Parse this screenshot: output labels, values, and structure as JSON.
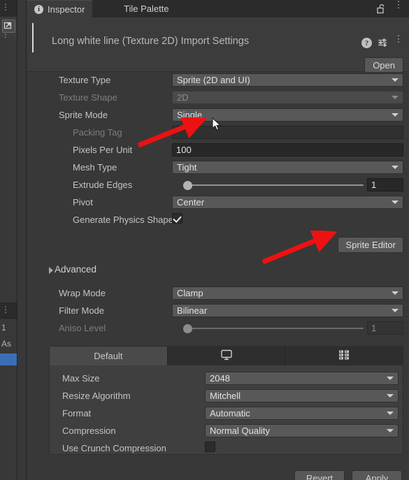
{
  "window": {
    "tabs": [
      {
        "label": "Inspector",
        "icon": "info-icon",
        "active": true
      },
      {
        "label": "Tile Palette",
        "icon": "",
        "active": false
      }
    ],
    "lock_icon": "padlock-open-icon",
    "menu_icon": "kebab-menu-icon"
  },
  "object_header": {
    "title": "Long white line (Texture 2D) Import Settings",
    "help_icon": "help-icon",
    "preset_icon": "preset-settings-icon",
    "menu_icon": "kebab-menu-icon",
    "open_button": "Open"
  },
  "properties": [
    {
      "label": "Texture Type",
      "indent": 1,
      "disabled": false,
      "type": "popup",
      "value": "Sprite (2D and UI)"
    },
    {
      "label": "Texture Shape",
      "indent": 1,
      "disabled": true,
      "type": "popup",
      "value": "2D"
    },
    {
      "label": "Sprite Mode",
      "indent": 1,
      "disabled": false,
      "type": "popup",
      "value": "Single"
    },
    {
      "label": "Packing Tag",
      "indent": 2,
      "disabled": true,
      "type": "text",
      "value": ""
    },
    {
      "label": "Pixels Per Unit",
      "indent": 2,
      "disabled": false,
      "type": "text",
      "value": "100"
    },
    {
      "label": "Mesh Type",
      "indent": 2,
      "disabled": false,
      "type": "popup",
      "value": "Tight"
    },
    {
      "label": "Extrude Edges",
      "indent": 2,
      "disabled": false,
      "type": "slider",
      "value": "1",
      "fill": 0
    },
    {
      "label": "Pivot",
      "indent": 2,
      "disabled": false,
      "type": "popup",
      "value": "Center"
    },
    {
      "label": "Generate Physics Shape",
      "indent": 2,
      "disabled": false,
      "type": "toggle",
      "value": true
    }
  ],
  "sprite_editor_button": "Sprite Editor",
  "advanced_foldout": {
    "label": "Advanced",
    "expanded": false
  },
  "properties2": [
    {
      "label": "Wrap Mode",
      "indent": 1,
      "disabled": false,
      "type": "popup",
      "value": "Clamp"
    },
    {
      "label": "Filter Mode",
      "indent": 1,
      "disabled": false,
      "type": "popup",
      "value": "Bilinear"
    },
    {
      "label": "Aniso Level",
      "indent": 1,
      "disabled": true,
      "type": "slider",
      "value": "1",
      "fill": 0
    }
  ],
  "platform": {
    "tabs": [
      {
        "label": "Default",
        "icon": "",
        "active": true
      },
      {
        "label": "",
        "icon": "monitor-icon",
        "active": false
      },
      {
        "label": "",
        "icon": "build-stack-icon",
        "active": false
      }
    ],
    "settings": [
      {
        "label": "Max Size",
        "type": "popup",
        "value": "2048"
      },
      {
        "label": "Resize Algorithm",
        "type": "popup",
        "value": "Mitchell"
      },
      {
        "label": "Format",
        "type": "popup",
        "value": "Automatic"
      },
      {
        "label": "Compression",
        "type": "popup",
        "value": "Normal Quality"
      },
      {
        "label": "Use Crunch Compression",
        "type": "toggle",
        "value": false
      }
    ]
  },
  "footer": {
    "revert_button": "Revert",
    "apply_button": "Apply"
  },
  "left_strip": {
    "project_rows": [
      "1",
      "As"
    ]
  },
  "annotations": {
    "arrow_color": "#ee1111",
    "arrow_count": 2
  }
}
